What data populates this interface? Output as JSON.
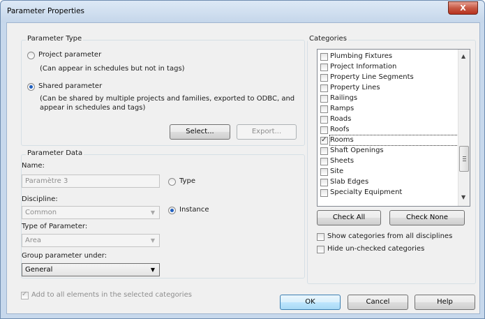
{
  "window": {
    "title": "Parameter Properties",
    "close_glyph": "X"
  },
  "parameter_type": {
    "group_label": "Parameter Type",
    "project_label": "Project parameter",
    "project_desc": "(Can appear in schedules but not in tags)",
    "shared_label": "Shared parameter",
    "shared_desc_line1": "(Can be shared by multiple projects and families, exported to ODBC, and",
    "shared_desc_line2": "appear in schedules and tags)",
    "selected": "shared",
    "select_button": "Select...",
    "export_button": "Export..."
  },
  "parameter_data": {
    "group_label": "Parameter Data",
    "name_label": "Name:",
    "name_value": "Paramètre 3",
    "type_radio": "Type",
    "instance_radio": "Instance",
    "selected_radio": "instance",
    "discipline_label": "Discipline:",
    "discipline_value": "Common",
    "type_of_parameter_label": "Type of Parameter:",
    "type_of_parameter_value": "Area",
    "group_under_label": "Group parameter under:",
    "group_under_value": "General"
  },
  "add_to_all": {
    "label": "Add to all elements in the selected categories",
    "checked": true
  },
  "categories": {
    "group_label": "Categories",
    "items": [
      {
        "label": "Plumbing Fixtures",
        "checked": false
      },
      {
        "label": "Project Information",
        "checked": false
      },
      {
        "label": "Property Line Segments",
        "checked": false
      },
      {
        "label": "Property Lines",
        "checked": false
      },
      {
        "label": "Railings",
        "checked": false
      },
      {
        "label": "Ramps",
        "checked": false
      },
      {
        "label": "Roads",
        "checked": false
      },
      {
        "label": "Roofs",
        "checked": false
      },
      {
        "label": "Rooms",
        "checked": true
      },
      {
        "label": "Shaft Openings",
        "checked": false
      },
      {
        "label": "Sheets",
        "checked": false
      },
      {
        "label": "Site",
        "checked": false
      },
      {
        "label": "Slab Edges",
        "checked": false
      },
      {
        "label": "Specialty Equipment",
        "checked": false
      }
    ],
    "check_all_button": "Check All",
    "check_none_button": "Check None",
    "show_all_disciplines_label": "Show categories from all disciplines",
    "hide_unchecked_label": "Hide un-checked categories"
  },
  "footer": {
    "ok_button": "OK",
    "cancel_button": "Cancel",
    "help_button": "Help"
  }
}
